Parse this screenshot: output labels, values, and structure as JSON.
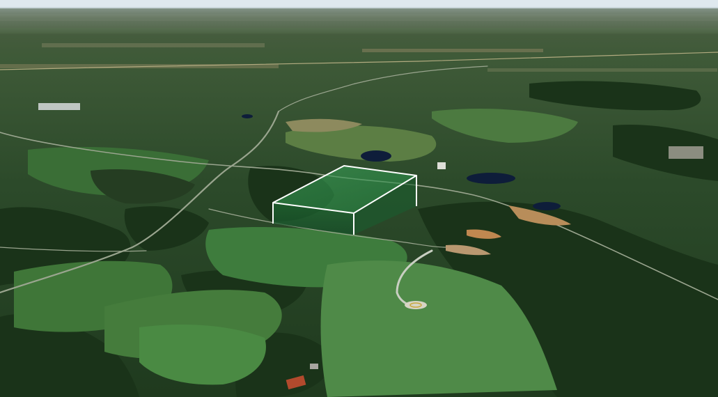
{
  "view": {
    "type": "3d-satellite-terrain",
    "sky_color": "#dfe8ee",
    "ground_color": "#2f4a2a"
  },
  "overlay": {
    "shape": "extruded-parcel-polygon",
    "fill_color": "#1e8a3f",
    "fill_opacity": 0.55,
    "edge_color": "#ffffff"
  },
  "features": {
    "ponds": 4,
    "helipad": true,
    "buildings_red_roof": 1
  }
}
